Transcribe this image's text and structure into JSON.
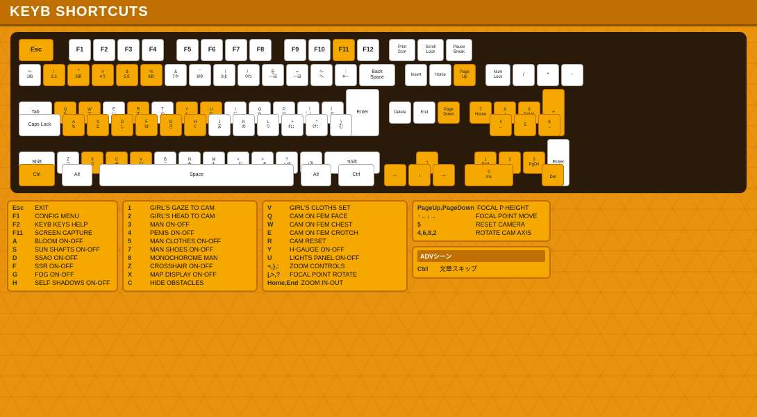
{
  "header": {
    "title": "KEYB SHORTCUTS"
  },
  "keyboard": {
    "rows": [
      {
        "keys": [
          {
            "label": "Esc",
            "type": "white wide"
          },
          {
            "label": "",
            "type": "spacer"
          },
          {
            "label": "F1",
            "type": "white"
          },
          {
            "label": "F2",
            "type": "white"
          },
          {
            "label": "F3",
            "type": "white"
          },
          {
            "label": "F4",
            "type": "white"
          },
          {
            "label": "",
            "type": "spacer-sm"
          },
          {
            "label": "F5",
            "type": "white"
          },
          {
            "label": "F6",
            "type": "white"
          },
          {
            "label": "F7",
            "type": "white"
          },
          {
            "label": "F8",
            "type": "white"
          },
          {
            "label": "",
            "type": "spacer-sm"
          },
          {
            "label": "F9",
            "type": "white"
          },
          {
            "label": "F10",
            "type": "white"
          },
          {
            "label": "F11",
            "type": "white"
          },
          {
            "label": "F12",
            "type": "white"
          },
          {
            "label": "",
            "type": "spacer-sm"
          },
          {
            "label": "Print Scrn",
            "type": "white small"
          },
          {
            "label": "Scroll Lock",
            "type": "white small"
          },
          {
            "label": "Pause Break",
            "type": "white small"
          }
        ]
      }
    ]
  },
  "panels": {
    "left": {
      "shortcuts": [
        {
          "key": "Esc",
          "desc": "EXIT"
        },
        {
          "key": "F1",
          "desc": "CONFIG MENU"
        },
        {
          "key": "F2",
          "desc": "KEYB KEYS HELP"
        },
        {
          "key": "F11",
          "desc": "SCREEN CAPTURE"
        },
        {
          "key": "A",
          "desc": "BLOOM ON-OFF"
        },
        {
          "key": "S",
          "desc": "SUN SHAFTS ON-OFF"
        },
        {
          "key": "D",
          "desc": "SSAO ON-OFF"
        },
        {
          "key": "F",
          "desc": "SSR ON-OFF"
        },
        {
          "key": "G",
          "desc": "FOG ON-OFF"
        },
        {
          "key": "H",
          "desc": "SELF SHADOWS ON-OFF"
        }
      ]
    },
    "mid1": {
      "shortcuts": [
        {
          "key": "1",
          "desc": "GIRL'S GAZE TO CAM"
        },
        {
          "key": "2",
          "desc": "GIRL'S HEAD TO CAM"
        },
        {
          "key": "3",
          "desc": "MAN ON-OFF"
        },
        {
          "key": "4",
          "desc": "PENIS ON-OFF"
        },
        {
          "key": "5",
          "desc": "MAN CLOTHES ON-OFF"
        },
        {
          "key": "7",
          "desc": "MAN SHOES ON-OFF"
        },
        {
          "key": "8",
          "desc": "MONOCHOROME MAN"
        },
        {
          "key": "Z",
          "desc": "CROSSHAIR ON-OFF"
        },
        {
          "key": "X",
          "desc": "MAP DISPLAY ON-OFF"
        },
        {
          "key": "C",
          "desc": "HIDE OBSTACLES"
        }
      ]
    },
    "mid2": {
      "shortcuts": [
        {
          "key": "V",
          "desc": "GIRL'S CLOTHS SET"
        },
        {
          "key": "Q",
          "desc": "CAM ON FEM FACE"
        },
        {
          "key": "W",
          "desc": "CAM ON FEM CHEST"
        },
        {
          "key": "E",
          "desc": "CAM ON FEM CROTCH"
        },
        {
          "key": "R",
          "desc": "CAM RESET"
        },
        {
          "key": "Y",
          "desc": "H-GAUGE ON-OFF"
        },
        {
          "key": "U",
          "desc": "LIGHTS PANEL ON-OFF"
        },
        {
          "key": "+,},:",
          "desc": "ZOOM CONTROLS"
        },
        {
          "key": "|,>,?",
          "desc": "FOCAL POINT ROTATE"
        },
        {
          "key": "Home,End",
          "desc": "ZOOM IN-OUT"
        }
      ]
    },
    "right": {
      "shortcuts": [
        {
          "key": "PageUp,PageDown",
          "desc": "FOCAL P HEIGHT"
        },
        {
          "key": "↑←↓→",
          "desc": "FOCAL POINT MOVE"
        },
        {
          "key": "5",
          "desc": "RESET CAMERA"
        },
        {
          "key": "4,6,8,2",
          "desc": "ROTATE CAM AXIS"
        }
      ]
    },
    "adv": {
      "title": "ADVシーン",
      "shortcuts": [
        {
          "key": "Ctrl",
          "desc": "文章スキップ"
        }
      ]
    }
  }
}
